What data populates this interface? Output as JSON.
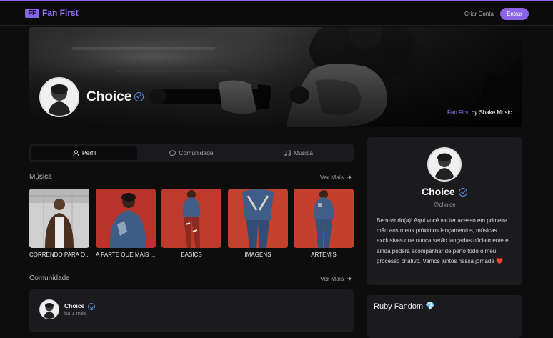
{
  "header": {
    "logo_mark": "FF",
    "logo_text": "Fan First",
    "create_account": "Criar Conta",
    "login": "Entrar"
  },
  "banner": {
    "artist_name": "Choice",
    "credit_brand": "Fan First",
    "credit_suffix": " by Shake Music"
  },
  "tabs": [
    {
      "label": "Perfil",
      "icon": "user-icon",
      "active": true
    },
    {
      "label": "Comunidade",
      "icon": "chat-bubble-icon",
      "active": false
    },
    {
      "label": "Música",
      "icon": "music-note-icon",
      "active": false
    }
  ],
  "music_section": {
    "title": "Música",
    "see_more": "Ver Mais"
  },
  "albums": [
    {
      "label": "CORRENDO PARA O...",
      "bg": "#bfbfbf"
    },
    {
      "label": "A PARTE QUE MAIS ...",
      "bg": "#c0392b"
    },
    {
      "label": "BASICS",
      "bg": "#c2402f"
    },
    {
      "label": "IMAGENS",
      "bg": "#c5432f"
    },
    {
      "label": "ARTEMIS",
      "bg": "#c8412f"
    }
  ],
  "community_section": {
    "title": "Comunidade",
    "see_more": "Ver Mais"
  },
  "post": {
    "author": "Choice",
    "time": "há 1 mês"
  },
  "profile": {
    "name": "Choice",
    "handle": "@choice",
    "bio": "Bem-vindo(a)! Aqui você vai ter acesso em primeira mão aos meus próximos lançamentos, músicas exclusivas que nunca serão lançadas oficialmente e ainda poderá acompanhar de perto todo o meu processo criativo. Vamos juntos nessa jornada ❤️"
  },
  "fandom": {
    "title": "Ruby Fandom 💎"
  },
  "colors": {
    "accent": "#8b63e6",
    "verified": "#5a8dea",
    "card": "#1b1b1d",
    "background": "#0d0d0e"
  }
}
